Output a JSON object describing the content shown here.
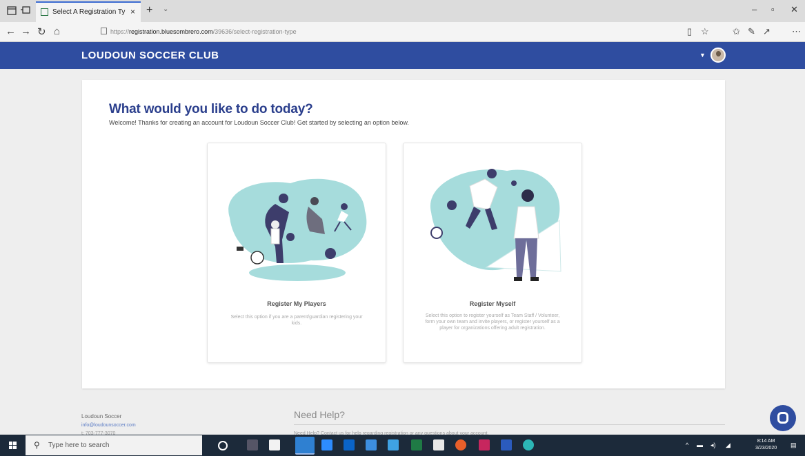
{
  "browser": {
    "tab_title": "Select A Registration Ty",
    "tab_close": "×",
    "new_tab": "+",
    "tab_dropdown": "⌄",
    "url_prefix": "https://",
    "url_domain": "registration.bluesombrero.com",
    "url_path": "/39636/select-registration-type",
    "window_minimize": "–",
    "window_maximize": "▫",
    "window_close": "✕"
  },
  "site": {
    "brand": "LOUDOUN SOCCER CLUB"
  },
  "main": {
    "heading": "What would you like to do today?",
    "subtext": "Welcome! Thanks for creating an account for Loudoun Soccer Club! Get started by selecting an option below.",
    "options": [
      {
        "title": "Register My Players",
        "description": "Select this option if you are a parent/guardian registering your kids."
      },
      {
        "title": "Register Myself",
        "description": "Select this option to register yourself as Team Staff / Volunteer, form your own team and invite players, or register yourself as a player for organizations offering adult registration."
      }
    ]
  },
  "footer": {
    "org_name": "Loudoun Soccer",
    "email": "info@loudounsoccer.com",
    "phone": "t: 703-777-3070",
    "need_help": "Need Help?",
    "help_text": "Need Help? Contact us for help regarding registration or any questions about your account."
  },
  "taskbar": {
    "search_placeholder": "Type here to search",
    "time": "8:14 AM",
    "date": "3/23/2020"
  },
  "colors": {
    "brand_blue": "#2f4da0",
    "illustration_teal": "#a6dcdc",
    "illustration_navy": "#3d3d6b"
  }
}
